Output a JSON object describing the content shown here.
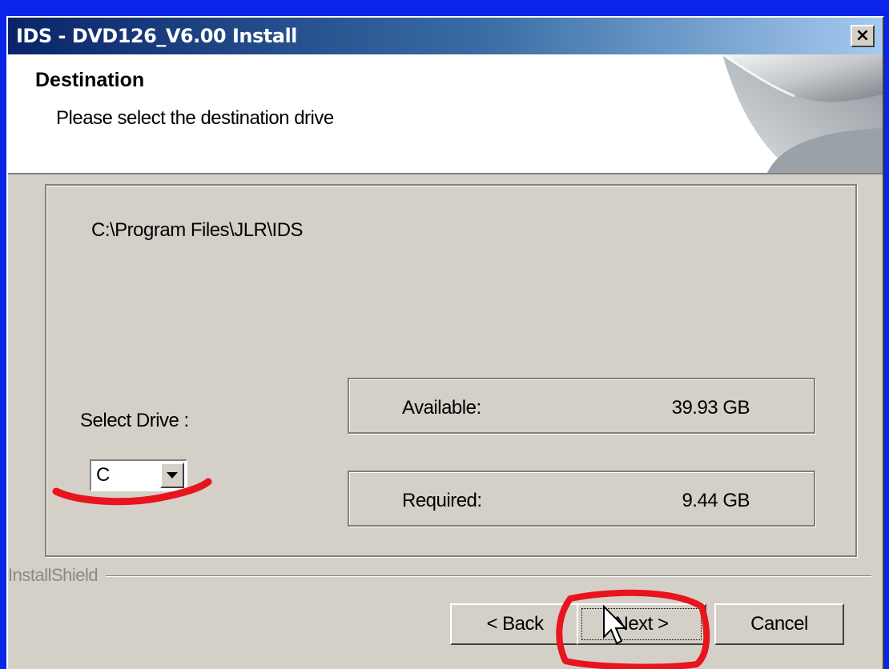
{
  "window": {
    "title": "IDS - DVD126_V6.00 Install",
    "close_label": "×"
  },
  "header": {
    "title": "Destination",
    "subtitle": "Please select the destination drive"
  },
  "panel": {
    "path": "C:\\Program Files\\JLR\\IDS",
    "select_drive_label": "Select Drive :",
    "drive_value": "C",
    "available_label": "Available:",
    "available_value": "39.93 GB",
    "required_label": "Required:",
    "required_value": "9.44 GB"
  },
  "footer": {
    "brand": "InstallShield",
    "back_label": "< Back",
    "next_label": "Next >",
    "cancel_label": "Cancel"
  },
  "colors": {
    "titlebar_start": "#0a246a",
    "titlebar_end": "#a6caf0",
    "dialog_bg": "#d4d0c8",
    "annotation": "#e8141e"
  },
  "icons": [
    "close-icon",
    "chevron-down-icon",
    "mouse-cursor-icon"
  ]
}
